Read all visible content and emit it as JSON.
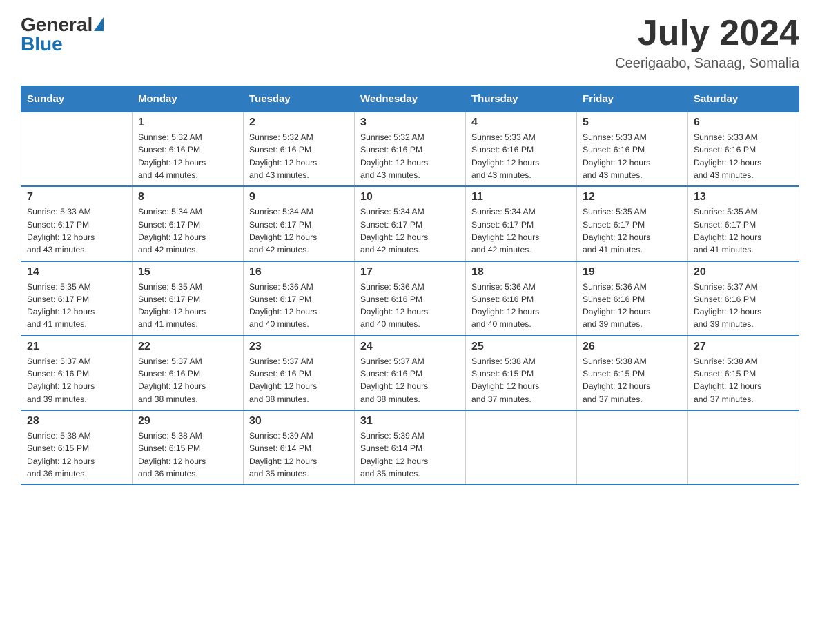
{
  "header": {
    "logo_general": "General",
    "logo_blue": "Blue",
    "month_title": "July 2024",
    "location": "Ceerigaabo, Sanaag, Somalia"
  },
  "weekdays": [
    "Sunday",
    "Monday",
    "Tuesday",
    "Wednesday",
    "Thursday",
    "Friday",
    "Saturday"
  ],
  "weeks": [
    [
      {
        "day": "",
        "info": ""
      },
      {
        "day": "1",
        "info": "Sunrise: 5:32 AM\nSunset: 6:16 PM\nDaylight: 12 hours\nand 44 minutes."
      },
      {
        "day": "2",
        "info": "Sunrise: 5:32 AM\nSunset: 6:16 PM\nDaylight: 12 hours\nand 43 minutes."
      },
      {
        "day": "3",
        "info": "Sunrise: 5:32 AM\nSunset: 6:16 PM\nDaylight: 12 hours\nand 43 minutes."
      },
      {
        "day": "4",
        "info": "Sunrise: 5:33 AM\nSunset: 6:16 PM\nDaylight: 12 hours\nand 43 minutes."
      },
      {
        "day": "5",
        "info": "Sunrise: 5:33 AM\nSunset: 6:16 PM\nDaylight: 12 hours\nand 43 minutes."
      },
      {
        "day": "6",
        "info": "Sunrise: 5:33 AM\nSunset: 6:16 PM\nDaylight: 12 hours\nand 43 minutes."
      }
    ],
    [
      {
        "day": "7",
        "info": "Sunrise: 5:33 AM\nSunset: 6:17 PM\nDaylight: 12 hours\nand 43 minutes."
      },
      {
        "day": "8",
        "info": "Sunrise: 5:34 AM\nSunset: 6:17 PM\nDaylight: 12 hours\nand 42 minutes."
      },
      {
        "day": "9",
        "info": "Sunrise: 5:34 AM\nSunset: 6:17 PM\nDaylight: 12 hours\nand 42 minutes."
      },
      {
        "day": "10",
        "info": "Sunrise: 5:34 AM\nSunset: 6:17 PM\nDaylight: 12 hours\nand 42 minutes."
      },
      {
        "day": "11",
        "info": "Sunrise: 5:34 AM\nSunset: 6:17 PM\nDaylight: 12 hours\nand 42 minutes."
      },
      {
        "day": "12",
        "info": "Sunrise: 5:35 AM\nSunset: 6:17 PM\nDaylight: 12 hours\nand 41 minutes."
      },
      {
        "day": "13",
        "info": "Sunrise: 5:35 AM\nSunset: 6:17 PM\nDaylight: 12 hours\nand 41 minutes."
      }
    ],
    [
      {
        "day": "14",
        "info": "Sunrise: 5:35 AM\nSunset: 6:17 PM\nDaylight: 12 hours\nand 41 minutes."
      },
      {
        "day": "15",
        "info": "Sunrise: 5:35 AM\nSunset: 6:17 PM\nDaylight: 12 hours\nand 41 minutes."
      },
      {
        "day": "16",
        "info": "Sunrise: 5:36 AM\nSunset: 6:17 PM\nDaylight: 12 hours\nand 40 minutes."
      },
      {
        "day": "17",
        "info": "Sunrise: 5:36 AM\nSunset: 6:16 PM\nDaylight: 12 hours\nand 40 minutes."
      },
      {
        "day": "18",
        "info": "Sunrise: 5:36 AM\nSunset: 6:16 PM\nDaylight: 12 hours\nand 40 minutes."
      },
      {
        "day": "19",
        "info": "Sunrise: 5:36 AM\nSunset: 6:16 PM\nDaylight: 12 hours\nand 39 minutes."
      },
      {
        "day": "20",
        "info": "Sunrise: 5:37 AM\nSunset: 6:16 PM\nDaylight: 12 hours\nand 39 minutes."
      }
    ],
    [
      {
        "day": "21",
        "info": "Sunrise: 5:37 AM\nSunset: 6:16 PM\nDaylight: 12 hours\nand 39 minutes."
      },
      {
        "day": "22",
        "info": "Sunrise: 5:37 AM\nSunset: 6:16 PM\nDaylight: 12 hours\nand 38 minutes."
      },
      {
        "day": "23",
        "info": "Sunrise: 5:37 AM\nSunset: 6:16 PM\nDaylight: 12 hours\nand 38 minutes."
      },
      {
        "day": "24",
        "info": "Sunrise: 5:37 AM\nSunset: 6:16 PM\nDaylight: 12 hours\nand 38 minutes."
      },
      {
        "day": "25",
        "info": "Sunrise: 5:38 AM\nSunset: 6:15 PM\nDaylight: 12 hours\nand 37 minutes."
      },
      {
        "day": "26",
        "info": "Sunrise: 5:38 AM\nSunset: 6:15 PM\nDaylight: 12 hours\nand 37 minutes."
      },
      {
        "day": "27",
        "info": "Sunrise: 5:38 AM\nSunset: 6:15 PM\nDaylight: 12 hours\nand 37 minutes."
      }
    ],
    [
      {
        "day": "28",
        "info": "Sunrise: 5:38 AM\nSunset: 6:15 PM\nDaylight: 12 hours\nand 36 minutes."
      },
      {
        "day": "29",
        "info": "Sunrise: 5:38 AM\nSunset: 6:15 PM\nDaylight: 12 hours\nand 36 minutes."
      },
      {
        "day": "30",
        "info": "Sunrise: 5:39 AM\nSunset: 6:14 PM\nDaylight: 12 hours\nand 35 minutes."
      },
      {
        "day": "31",
        "info": "Sunrise: 5:39 AM\nSunset: 6:14 PM\nDaylight: 12 hours\nand 35 minutes."
      },
      {
        "day": "",
        "info": ""
      },
      {
        "day": "",
        "info": ""
      },
      {
        "day": "",
        "info": ""
      }
    ]
  ]
}
